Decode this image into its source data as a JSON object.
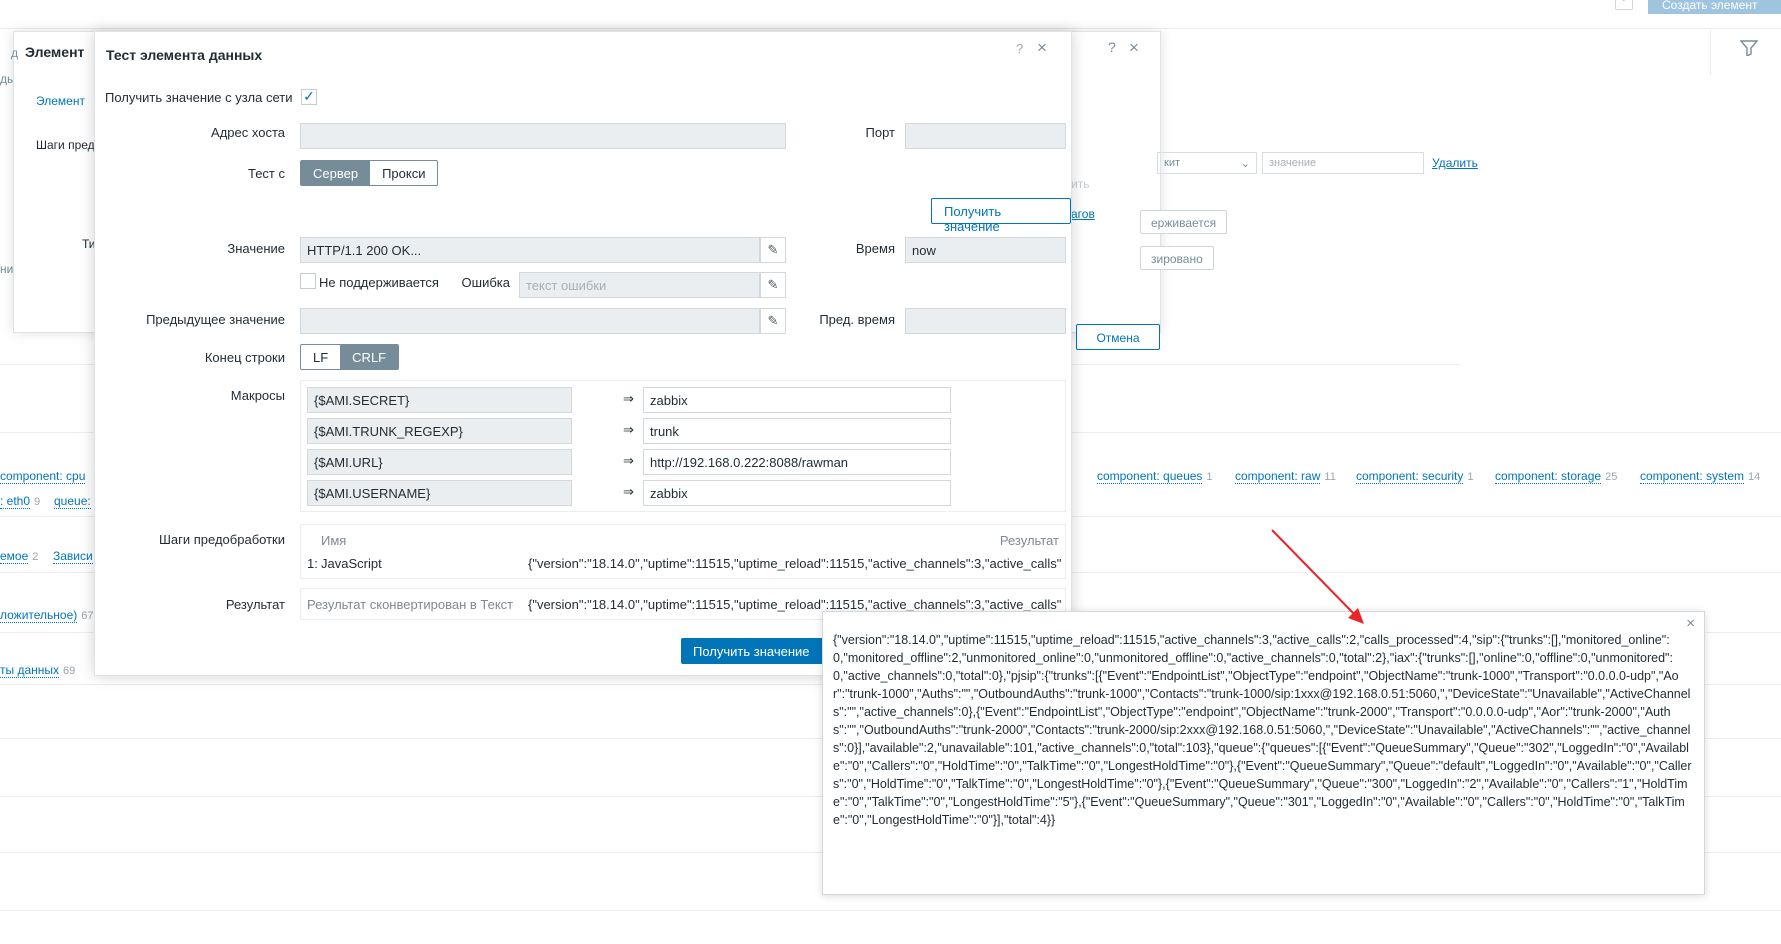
{
  "background": {
    "create_button": "Создать элемент д",
    "help": "?",
    "left_fragments": [
      "ды",
      "ни"
    ],
    "tags": [
      {
        "label": "component: cpu",
        "count": ""
      },
      {
        "label": "component: queues",
        "count": "1"
      },
      {
        "label": "component: raw",
        "count": "11"
      },
      {
        "label": "component: security",
        "count": "1"
      },
      {
        "label": "component: storage",
        "count": "25"
      },
      {
        "label": "component: system",
        "count": "14"
      }
    ],
    "tags_row2": [
      {
        "label": ": eth0",
        "count": "9"
      },
      {
        "label": "queue:",
        "count": ""
      }
    ],
    "links_col": [
      {
        "label": "емое",
        "count": "2"
      },
      {
        "label": "Зависи",
        "count": ""
      },
      {
        "label": "ложительное)",
        "count": "67"
      },
      {
        "label": "ты данных",
        "count": "69"
      }
    ]
  },
  "dialog_bg": {
    "title": "Элемент",
    "tab": "Элемент",
    "preproc_label": "Шаги пред",
    "type_label": "Ти",
    "left_fragment": "д",
    "help": "?",
    "close": "×",
    "select_value": "кит",
    "value_placeholder": "значение",
    "delete_label": "Удалить",
    "faded_label": "ить",
    "steps_link": "агов",
    "btn_unsupported": "ерживается",
    "btn_customized": "зировано",
    "cancel_label": "Отмена"
  },
  "dialog": {
    "title": "Тест элемента данных",
    "help": "?",
    "close": "×",
    "get_from_host": {
      "label": "Получить значение с узла сети",
      "checked": true
    },
    "host_address": {
      "label": "Адрес хоста",
      "value": ""
    },
    "port": {
      "label": "Порт",
      "value": ""
    },
    "test_with": {
      "label": "Тест с",
      "options": [
        "Сервер",
        "Прокси"
      ],
      "selected": "Сервер"
    },
    "get_value_button": "Получить значение",
    "value": {
      "label": "Значение",
      "value": "HTTP/1.1 200 OK..."
    },
    "time": {
      "label": "Время",
      "value": "now"
    },
    "not_supported": {
      "label": "Не поддерживается",
      "checked": false
    },
    "error": {
      "label": "Ошибка",
      "placeholder": "текст ошибки"
    },
    "prev_value": {
      "label": "Предыдущее значение",
      "value": ""
    },
    "prev_time": {
      "label": "Пред. время",
      "value": ""
    },
    "eol": {
      "label": "Конец строки",
      "options": [
        "LF",
        "CRLF"
      ],
      "selected": "CRLF"
    },
    "macros": {
      "label": "Макросы",
      "arrow": "⇒",
      "items": [
        {
          "name": "{$AMI.SECRET}",
          "value": "zabbix"
        },
        {
          "name": "{$AMI.TRUNK_REGEXP}",
          "value": "trunk"
        },
        {
          "name": "{$AMI.URL}",
          "value": "http://192.168.0.222:8088/rawman"
        },
        {
          "name": "{$AMI.USERNAME}",
          "value": "zabbix"
        }
      ]
    },
    "preprocessing": {
      "label": "Шаги предобработки",
      "col_name": "Имя",
      "col_result": "Результат",
      "steps": [
        {
          "num": "1:",
          "name": "JavaScript",
          "result": "{\"version\":\"18.14.0\",\"uptime\":11515,\"uptime_reload\":11515,\"active_channels\":3,\"active_calls\":2,\"calls_processed\":4"
        }
      ]
    },
    "result": {
      "label": "Результат",
      "note": "Результат сконвертирован в Текст",
      "value": "{\"version\":\"18.14.0\",\"uptime\":11515,\"uptime_reload\":11515,\"active_channels\":3,\"active_calls\":2,\"calls_processed\":4"
    },
    "footer_button": "Получить значение"
  },
  "result_hint": {
    "close": "×",
    "text": "{\"version\":\"18.14.0\",\"uptime\":11515,\"uptime_reload\":11515,\"active_channels\":3,\"active_calls\":2,\"calls_processed\":4,\"sip\":{\"trunks\":[],\"monitored_online\":0,\"monitored_offline\":2,\"unmonitored_online\":0,\"unmonitored_offline\":0,\"active_channels\":0,\"total\":2},\"iax\":{\"trunks\":[],\"online\":0,\"offline\":0,\"unmonitored\":0,\"active_channels\":0,\"total\":0},\"pjsip\":{\"trunks\":[{\"Event\":\"EndpointList\",\"ObjectType\":\"endpoint\",\"ObjectName\":\"trunk-1000\",\"Transport\":\"0.0.0.0-udp\",\"Aor\":\"trunk-1000\",\"Auths\":\"\",\"OutboundAuths\":\"trunk-1000\",\"Contacts\":\"trunk-1000/sip:1xxx@192.168.0.51:5060,\",\"DeviceState\":\"Unavailable\",\"ActiveChannels\":\"\",\"active_channels\":0},{\"Event\":\"EndpointList\",\"ObjectType\":\"endpoint\",\"ObjectName\":\"trunk-2000\",\"Transport\":\"0.0.0.0-udp\",\"Aor\":\"trunk-2000\",\"Auths\":\"\",\"OutboundAuths\":\"trunk-2000\",\"Contacts\":\"trunk-2000/sip:2xxx@192.168.0.51:5060,\",\"DeviceState\":\"Unavailable\",\"ActiveChannels\":\"\",\"active_channels\":0}],\"available\":2,\"unavailable\":101,\"active_channels\":0,\"total\":103},\"queue\":{\"queues\":[{\"Event\":\"QueueSummary\",\"Queue\":\"302\",\"LoggedIn\":\"0\",\"Available\":\"0\",\"Callers\":\"0\",\"HoldTime\":\"0\",\"TalkTime\":\"0\",\"LongestHoldTime\":\"0\"},{\"Event\":\"QueueSummary\",\"Queue\":\"default\",\"LoggedIn\":\"0\",\"Available\":\"0\",\"Callers\":\"0\",\"HoldTime\":\"0\",\"TalkTime\":\"0\",\"LongestHoldTime\":\"0\"},{\"Event\":\"QueueSummary\",\"Queue\":\"300\",\"LoggedIn\":\"2\",\"Available\":\"0\",\"Callers\":\"1\",\"HoldTime\":\"0\",\"TalkTime\":\"0\",\"LongestHoldTime\":\"5\"},{\"Event\":\"QueueSummary\",\"Queue\":\"301\",\"LoggedIn\":\"0\",\"Available\":\"0\",\"Callers\":\"0\",\"HoldTime\":\"0\",\"TalkTime\":\"0\",\"LongestHoldTime\":\"0\"}],\"total\":4}}"
  },
  "annotation": {
    "arrow_color": "#e8262a"
  }
}
